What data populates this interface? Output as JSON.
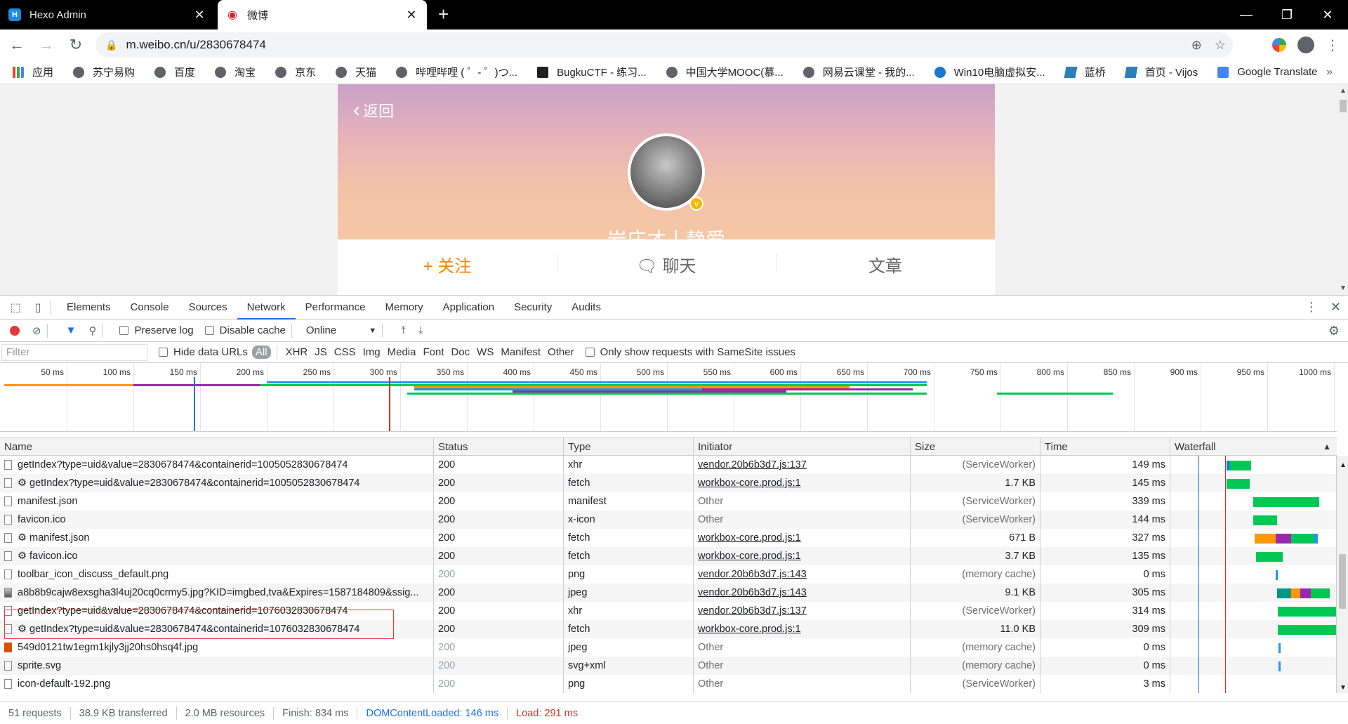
{
  "tabs": [
    {
      "title": "Hexo Admin",
      "favicon": "H",
      "active": false
    },
    {
      "title": "微博",
      "favicon": "weibo-logo",
      "active": true
    }
  ],
  "address": {
    "url": "m.weibo.cn/u/2830678474"
  },
  "bookmarks": [
    {
      "label": "应用",
      "icon": "apps-icon"
    },
    {
      "label": "苏宁易购",
      "icon": "globe-icon"
    },
    {
      "label": "百度",
      "icon": "globe-icon"
    },
    {
      "label": "淘宝",
      "icon": "globe-icon"
    },
    {
      "label": "京东",
      "icon": "globe-icon"
    },
    {
      "label": "天猫",
      "icon": "globe-icon"
    },
    {
      "label": "哔哩哔哩 ( ゜- ゜)つ...",
      "icon": "globe-icon"
    },
    {
      "label": "BugkuCTF - 练习...",
      "icon": "flag-icon"
    },
    {
      "label": "中国大学MOOC(慕...",
      "icon": "globe-icon"
    },
    {
      "label": "网易云课堂 - 我的...",
      "icon": "globe-icon"
    },
    {
      "label": "Win10电脑虚拟安...",
      "icon": "paw-icon"
    },
    {
      "label": "蓝桥",
      "icon": "vijos-icon"
    },
    {
      "label": "首页 - Vijos",
      "icon": "vijos-icon"
    },
    {
      "label": "Google Translate",
      "icon": "translate-icon"
    }
  ],
  "bookmarks_more": "»",
  "weibo": {
    "back": "返回",
    "nickname": "岩庄才丨静爱",
    "verified_badge": "v",
    "actions": {
      "follow": "+ 关注",
      "chat": "聊天",
      "article": "文章"
    }
  },
  "devtools": {
    "tabs": [
      "Elements",
      "Console",
      "Sources",
      "Network",
      "Performance",
      "Memory",
      "Application",
      "Security",
      "Audits"
    ],
    "active_tab": "Network",
    "toolbar": {
      "preserve_log": "Preserve log",
      "disable_cache": "Disable cache",
      "throttle": "Online"
    },
    "filter": {
      "placeholder": "Filter",
      "hide_data_urls": "Hide data URLs",
      "types": [
        "All",
        "XHR",
        "JS",
        "CSS",
        "Img",
        "Media",
        "Font",
        "Doc",
        "WS",
        "Manifest",
        "Other"
      ],
      "samesite": "Only show requests with SameSite issues"
    },
    "timeline_ticks": [
      "50 ms",
      "100 ms",
      "150 ms",
      "200 ms",
      "250 ms",
      "300 ms",
      "350 ms",
      "400 ms",
      "450 ms",
      "500 ms",
      "550 ms",
      "600 ms",
      "650 ms",
      "700 ms",
      "750 ms",
      "800 ms",
      "850 ms",
      "900 ms",
      "950 ms",
      "1000 ms"
    ],
    "columns": {
      "name": "Name",
      "status": "Status",
      "type": "Type",
      "initiator": "Initiator",
      "size": "Size",
      "time": "Time",
      "waterfall": "Waterfall"
    },
    "requests": [
      {
        "name": "getIndex?type=uid&value=2830678474&containerid=1005052830678474",
        "status": "200",
        "type": "xhr",
        "initiator": "vendor.20b6b3d7.js:137",
        "initiator_link": true,
        "size": "(ServiceWorker)",
        "time": "149 ms",
        "icon": "doc"
      },
      {
        "name": "⚙ getIndex?type=uid&value=2830678474&containerid=1005052830678474",
        "status": "200",
        "type": "fetch",
        "initiator": "workbox-core.prod.js:1",
        "initiator_link": true,
        "size": "1.7 KB",
        "time": "145 ms",
        "icon": "doc"
      },
      {
        "name": "manifest.json",
        "status": "200",
        "type": "manifest",
        "initiator": "Other",
        "initiator_link": false,
        "size": "(ServiceWorker)",
        "time": "339 ms",
        "icon": "doc"
      },
      {
        "name": "favicon.ico",
        "status": "200",
        "type": "x-icon",
        "initiator": "Other",
        "initiator_link": false,
        "size": "(ServiceWorker)",
        "time": "144 ms",
        "icon": "doc"
      },
      {
        "name": "⚙ manifest.json",
        "status": "200",
        "type": "fetch",
        "initiator": "workbox-core.prod.js:1",
        "initiator_link": true,
        "size": "671 B",
        "time": "327 ms",
        "icon": "doc"
      },
      {
        "name": "⚙ favicon.ico",
        "status": "200",
        "type": "fetch",
        "initiator": "workbox-core.prod.js:1",
        "initiator_link": true,
        "size": "3.7 KB",
        "time": "135 ms",
        "icon": "doc"
      },
      {
        "name": "toolbar_icon_discuss_default.png",
        "status": "200",
        "type": "png",
        "initiator": "vendor.20b6b3d7.js:143",
        "initiator_link": true,
        "size": "(memory cache)",
        "time": "0 ms",
        "icon": "doc",
        "muted_status": true
      },
      {
        "name": "a8b8b9cajw8exsgha3l4uj20cq0crmy5.jpg?KID=imgbed,tva&Expires=1587184809&ssig...",
        "status": "200",
        "type": "jpeg",
        "initiator": "vendor.20b6b3d7.js:143",
        "initiator_link": true,
        "size": "9.1 KB",
        "time": "305 ms",
        "icon": "img"
      },
      {
        "name": "getIndex?type=uid&value=2830678474&containerid=1076032830678474",
        "status": "200",
        "type": "xhr",
        "initiator": "vendor.20b6b3d7.js:137",
        "initiator_link": true,
        "size": "(ServiceWorker)",
        "time": "314 ms",
        "icon": "doc"
      },
      {
        "name": "⚙ getIndex?type=uid&value=2830678474&containerid=1076032830678474",
        "status": "200",
        "type": "fetch",
        "initiator": "workbox-core.prod.js:1",
        "initiator_link": true,
        "size": "11.0 KB",
        "time": "309 ms",
        "icon": "doc"
      },
      {
        "name": "549d0121tw1egm1kjly3jj20hs0hsq4f.jpg",
        "status": "200",
        "type": "jpeg",
        "initiator": "Other",
        "initiator_link": false,
        "size": "(memory cache)",
        "time": "0 ms",
        "icon": "jpg",
        "muted_status": true
      },
      {
        "name": "sprite.svg",
        "status": "200",
        "type": "svg+xml",
        "initiator": "Other",
        "initiator_link": false,
        "size": "(memory cache)",
        "time": "0 ms",
        "icon": "doc",
        "muted_status": true
      },
      {
        "name": "icon-default-192.png",
        "status": "200",
        "type": "png",
        "initiator": "Other",
        "initiator_link": false,
        "size": "(ServiceWorker)",
        "time": "3 ms",
        "icon": "doc",
        "muted_status": true
      }
    ],
    "summary": {
      "requests": "51 requests",
      "transferred": "38.9 KB transferred",
      "resources": "2.0 MB resources",
      "finish": "Finish: 834 ms",
      "domcontentloaded": "DOMContentLoaded: 146 ms",
      "load": "Load: 291 ms"
    },
    "colors": {
      "waiting": "#00c853",
      "stalled": "#9e9e9e",
      "dns": "#009688",
      "connect": "#ff9800",
      "ssl": "#9c27b0",
      "send": "#2196f3",
      "dcl_line": "#1a73e8",
      "load_line": "#d93025"
    }
  }
}
